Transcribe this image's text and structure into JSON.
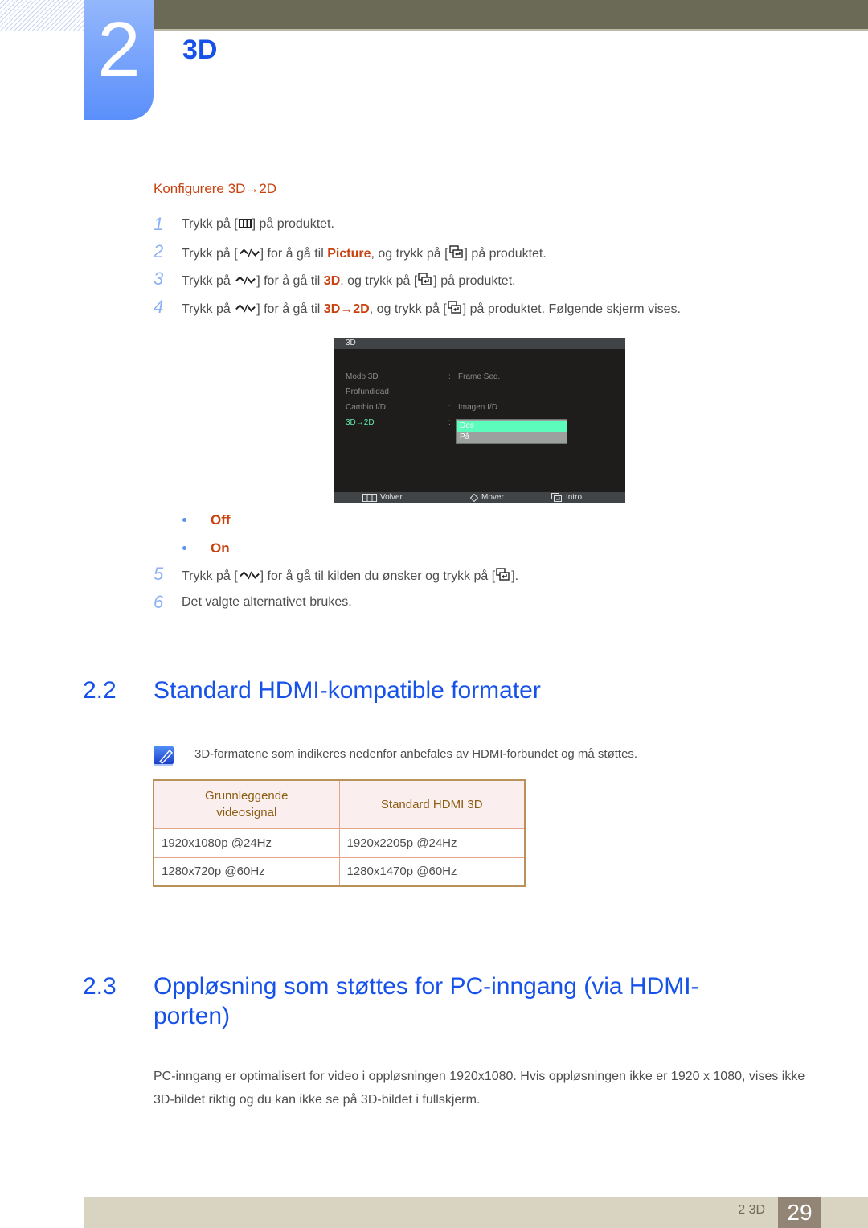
{
  "header": {
    "chapter_number": "2",
    "chapter_title": "3D"
  },
  "section_configure": {
    "title": "Konfigurere 3D→2D",
    "steps": [
      {
        "num": "1",
        "parts": [
          "Trykk på [",
          "menu-key",
          "] på produktet."
        ]
      },
      {
        "num": "2"
      },
      {
        "num": "3"
      },
      {
        "num": "4"
      }
    ],
    "step1": {
      "a": "Trykk på [",
      "b": "] på produktet."
    },
    "step2": {
      "a": "Trykk på [",
      "b": "] for å gå til ",
      "hl": "Picture",
      "c": ", og trykk på [",
      "d": "] på produktet."
    },
    "step3": {
      "a": "Trykk på ",
      "b": "] for å gå til ",
      "hl": "3D",
      "c": ", og trykk på [",
      "d": "] på produktet."
    },
    "step4": {
      "a": "Trykk på ",
      "b": "] for å gå til ",
      "hl": "3D→2D",
      "c": ", og trykk på [",
      "d": "] på produktet. Følgende skjerm vises."
    },
    "options": [
      "Off",
      "On"
    ],
    "step5": {
      "num": "5",
      "a": "Trykk på [",
      "b": "] for å gå til kilden du ønsker og trykk på [",
      "c": "]."
    },
    "step6": {
      "num": "6",
      "text": "Det valgte alternativet brukes."
    }
  },
  "osd": {
    "title": "3D",
    "rows": [
      {
        "label": "Modo 3D",
        "colon": ":",
        "value": "Frame Seq."
      },
      {
        "label": "Profundidad",
        "colon": "",
        "value": ""
      },
      {
        "label": "Cambio I/D",
        "colon": ":",
        "value": "Imagen I/D"
      },
      {
        "label": "3D→2D",
        "colon": ":",
        "value": ""
      }
    ],
    "dropdown": {
      "selected": "Des",
      "options": [
        "Des",
        "På"
      ]
    },
    "footer": {
      "back": "Volver",
      "move": "Mover",
      "enter": "Intro"
    }
  },
  "section_22": {
    "number": "2.2",
    "title": "Standard HDMI-kompatible formater",
    "note": "3D-formatene som indikeres nedenfor anbefales av HDMI-forbundet og må støttes.",
    "table": {
      "headers": [
        "Grunnleggende videosignal",
        "Standard HDMI 3D"
      ],
      "header_lines": [
        [
          "Grunnleggende",
          "videosignal"
        ],
        [
          "Standard HDMI 3D"
        ]
      ],
      "rows": [
        [
          "1920x1080p @24Hz",
          "1920x2205p @24Hz"
        ],
        [
          "1280x720p @60Hz",
          "1280x1470p @60Hz"
        ]
      ]
    }
  },
  "section_23": {
    "number": "2.3",
    "title_line1": "Oppløsning som støttes for PC-inngang (via HDMI-",
    "title_line2": "porten)",
    "paragraph": "PC-inngang er optimalisert for video i oppløsningen 1920x1080. Hvis oppløsningen ikke er 1920 x 1080, vises ikke 3D-bildet riktig og du kan ikke se på 3D-bildet i fullskjerm."
  },
  "footer": {
    "section_label": "2 3D",
    "page_number": "29"
  },
  "colors": {
    "heading_blue": "#1652e9",
    "highlight_orange": "#c8410e",
    "top_bar": "#6b6a57",
    "footer_bar": "#d9d3c1",
    "page_box": "#928576",
    "osd_selected": "#5cfdbc"
  }
}
